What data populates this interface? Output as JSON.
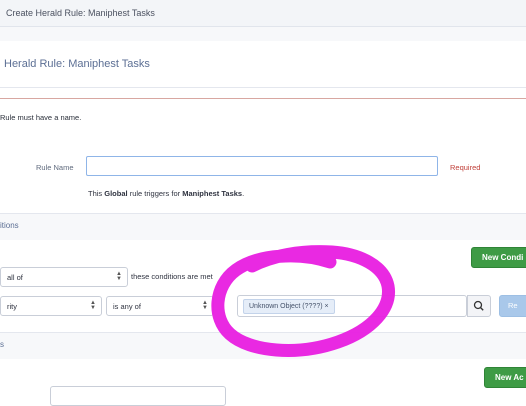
{
  "breadcrumb": {
    "text": "Create Herald Rule: Maniphest Tasks"
  },
  "header": {
    "title": "Herald Rule: Maniphest Tasks"
  },
  "error": {
    "message": "Rule must have a name."
  },
  "form": {
    "rule_name_label": "Rule Name",
    "rule_name_value": "",
    "required_label": "Required",
    "desc_prefix": "This ",
    "desc_scope": "Global",
    "desc_middle": " rule triggers for ",
    "desc_object": "Maniphest Tasks",
    "desc_suffix": "."
  },
  "conditions_section": {
    "label": "itions",
    "new_condition_label": "New Condi",
    "match_select_value": "all of",
    "match_text": "these conditions are met",
    "row": {
      "field_value": "rity",
      "operator_value": "is any of",
      "token_label": "Unknown Object (????)",
      "token_remove": "×",
      "remove_label": "Re"
    }
  },
  "actions_section": {
    "label": "s",
    "new_action_label": "New Ac"
  },
  "colors": {
    "green_button": "#3e9b45",
    "required_red": "#c0403a",
    "error_border": "#d8a7a1",
    "annotation_magenta": "#e81ee0"
  },
  "icons": {
    "search": "search-icon",
    "select_arrows": "select-arrows-icon"
  }
}
